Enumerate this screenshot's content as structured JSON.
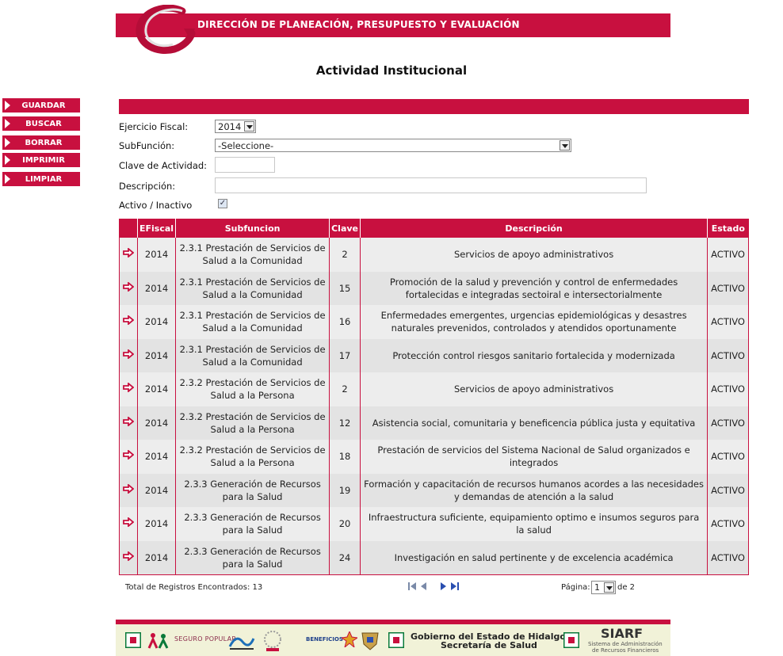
{
  "header": {
    "title": "DIRECCIÓN DE PLANEACIÓN, PRESUPUESTO Y EVALUACIÓN",
    "brand_color": "#c8103f"
  },
  "page_title": "Actividad Institucional",
  "sidebar": {
    "buttons": [
      "GUARDAR",
      "BUSCAR",
      "BORRAR",
      "IMPRIMIR",
      "LIMPIAR"
    ]
  },
  "form": {
    "ejercicio_label": "Ejercicio Fiscal:",
    "ejercicio_value": "2014",
    "subfuncion_label": "SubFunción:",
    "subfuncion_value": "-Seleccione-",
    "clave_label": "Clave de Actividad:",
    "clave_value": "",
    "descripcion_label": "Descripción:",
    "descripcion_value": "",
    "activo_label": "Activo / Inactivo",
    "activo_checked": true
  },
  "table": {
    "columns": [
      "EFiscal",
      "Subfuncion",
      "Clave",
      "Descripción",
      "Estado"
    ],
    "rows": [
      [
        "2014",
        "2.3.1 Prestación de Servicios de Salud a la Comunidad",
        "2",
        "Servicios de apoyo administrativos",
        "ACTIVO"
      ],
      [
        "2014",
        "2.3.1 Prestación de Servicios de Salud a la Comunidad",
        "15",
        "Promoción de la salud y prevención y control de enfermedades fortalecidas e integradas sectoiral e intersectorialmente",
        "ACTIVO"
      ],
      [
        "2014",
        "2.3.1 Prestación de Servicios de Salud a la Comunidad",
        "16",
        "Enfermedades emergentes, urgencias epidemiológicas y desastres naturales prevenidos, controlados y atendidos oportunamente",
        "ACTIVO"
      ],
      [
        "2014",
        "2.3.1 Prestación de Servicios de Salud a la Comunidad",
        "17",
        "Protección control riesgos sanitario fortalecida y modernizada",
        "ACTIVO"
      ],
      [
        "2014",
        "2.3.2 Prestación de Servicios de Salud a la Persona",
        "2",
        "Servicios de apoyo administrativos",
        "ACTIVO"
      ],
      [
        "2014",
        "2.3.2 Prestación de Servicios de Salud a la Persona",
        "12",
        "Asistencia social, comunitaria y beneficencia pública justa y equitativa",
        "ACTIVO"
      ],
      [
        "2014",
        "2.3.2 Prestación de Servicios de Salud a la Persona",
        "18",
        "Prestación de servicios del Sistema Nacional de Salud organizados e integrados",
        "ACTIVO"
      ],
      [
        "2014",
        "2.3.3 Generación de Recursos para la Salud",
        "19",
        "Formación y capacitación de recursos humanos acordes a las necesidades y demandas de atención a la salud",
        "ACTIVO"
      ],
      [
        "2014",
        "2.3.3 Generación de Recursos para la Salud",
        "20",
        "Infraestructura suficiente, equipamiento optimo e insumos seguros para la salud",
        "ACTIVO"
      ],
      [
        "2014",
        "2.3.3 Generación de Recursos para la Salud",
        "24",
        "Investigación en salud pertinente y de excelencia académica",
        "ACTIVO"
      ]
    ]
  },
  "pager": {
    "total_text": "Total de Registros Encontrados: 13",
    "page_label": "Página:",
    "page_value": "1",
    "of_text": "de 2"
  },
  "footer": {
    "seguro_popular": "SEGURO POPULAR",
    "beneficios": "BENEFICIOS",
    "gobierno_line1": "Gobierno del Estado de Hidalgo",
    "gobierno_line2": "Secretaría de Salud",
    "siarf_title": "SIARF",
    "siarf_sub1": "Sistema de Administración",
    "siarf_sub2": "de Recursos Financieros"
  }
}
